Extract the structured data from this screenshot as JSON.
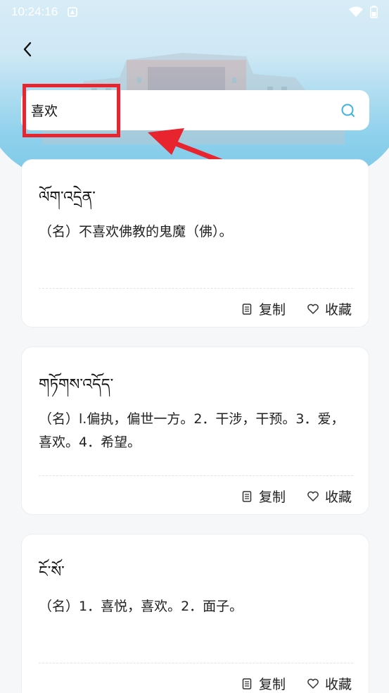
{
  "status_bar": {
    "time": "10:24:16"
  },
  "search": {
    "value": "喜欢"
  },
  "results": [
    {
      "word": "ལོག་འདྲེན་",
      "definition": "（名）不喜欢佛教的鬼魔（佛）。",
      "copy_label": "复制",
      "fav_label": "收藏"
    },
    {
      "word": "གཏོགས་འདོད་",
      "definition": "（名）l.偏执，偏世一方。2．干涉，干预。3．爱，喜欢。4．希望。",
      "copy_label": "复制",
      "fav_label": "收藏"
    },
    {
      "word": "ངོ་སོ་",
      "definition": "（名）1．喜悦，喜欢。2．面子。",
      "copy_label": "复制",
      "fav_label": "收藏"
    }
  ],
  "colors": {
    "accent": "#3db4de",
    "annotation": "#e8242e"
  }
}
